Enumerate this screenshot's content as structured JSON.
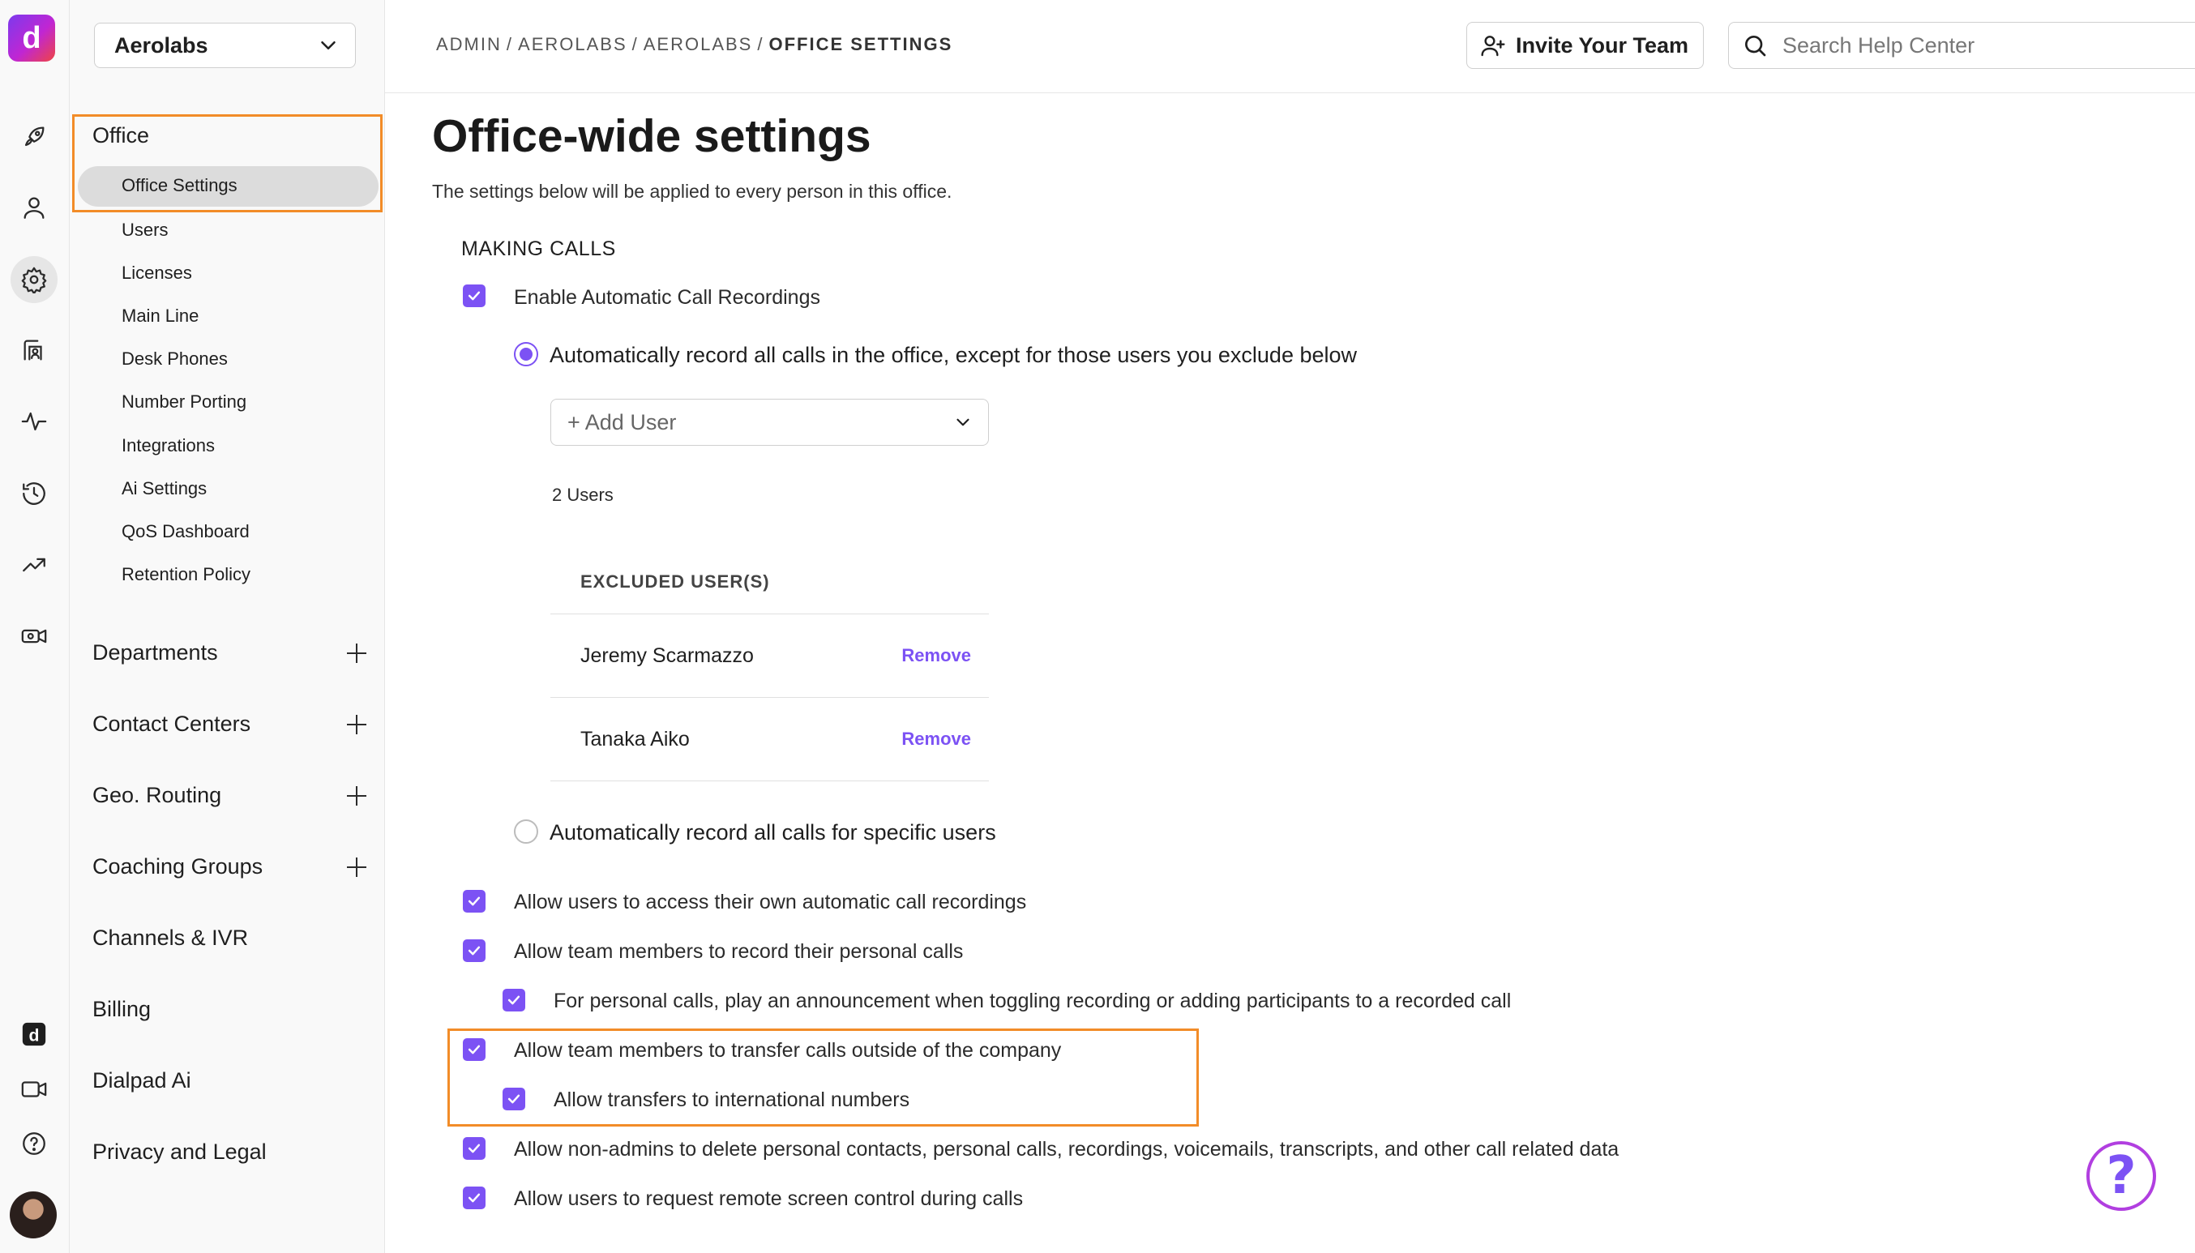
{
  "app": {
    "logo_glyph": "d",
    "accent_color": "#7c52f4",
    "highlight_color": "#f28c28"
  },
  "rail": {
    "icons": [
      "rocket-icon",
      "user-icon",
      "gear-icon",
      "contacts-icon",
      "activity-icon",
      "history-icon",
      "trending-icon",
      "video-settings-icon",
      "dialpad-app-icon",
      "meetings-video-icon",
      "help-circle-icon"
    ]
  },
  "sidebar": {
    "org_name": "Aerolabs",
    "office_heading": "Office",
    "office_items": [
      "Office Settings",
      "Users",
      "Licenses",
      "Main Line",
      "Desk Phones",
      "Number Porting",
      "Integrations",
      "Ai Settings",
      "QoS Dashboard",
      "Retention Policy"
    ],
    "groups": [
      {
        "label": "Departments",
        "expandable": true
      },
      {
        "label": "Contact Centers",
        "expandable": true
      },
      {
        "label": "Geo. Routing",
        "expandable": true
      },
      {
        "label": "Coaching Groups",
        "expandable": true
      },
      {
        "label": "Channels & IVR",
        "expandable": false
      },
      {
        "label": "Billing",
        "expandable": false
      },
      {
        "label": "Dialpad Ai",
        "expandable": false
      },
      {
        "label": "Privacy and Legal",
        "expandable": false
      }
    ]
  },
  "topbar": {
    "breadcrumb": [
      "ADMIN",
      "AEROLABS",
      "AEROLABS",
      "OFFICE SETTINGS"
    ],
    "invite_label": "Invite Your Team",
    "search_placeholder": "Search Help Center"
  },
  "main": {
    "title": "Office-wide settings",
    "description": "The settings below will be applied to every person in this office.",
    "section_title": "MAKING CALLS",
    "enable_recordings": "Enable Automatic Call Recordings",
    "radio_all_except": "Automatically record all calls in the office, except for those users you exclude below",
    "add_user_placeholder": "+ Add User",
    "users_count": "2 Users",
    "excluded_header": "EXCLUDED USER(S)",
    "excluded_users": [
      {
        "name": "Jeremy Scarmazzo",
        "action": "Remove"
      },
      {
        "name": "Tanaka Aiko",
        "action": "Remove"
      }
    ],
    "radio_specific": "Automatically record all calls for specific users",
    "options": [
      "Allow users to access their own automatic call recordings",
      "Allow team members to record their personal calls",
      "For personal calls, play an announcement when toggling recording or adding participants to a recorded call",
      "Allow team members to transfer calls outside of the company",
      "Allow transfers to international numbers",
      "Allow non-admins to delete personal contacts, personal calls, recordings, voicemails, transcripts, and other call related data",
      "Allow users to request remote screen control during calls"
    ]
  },
  "help_fab": "?"
}
